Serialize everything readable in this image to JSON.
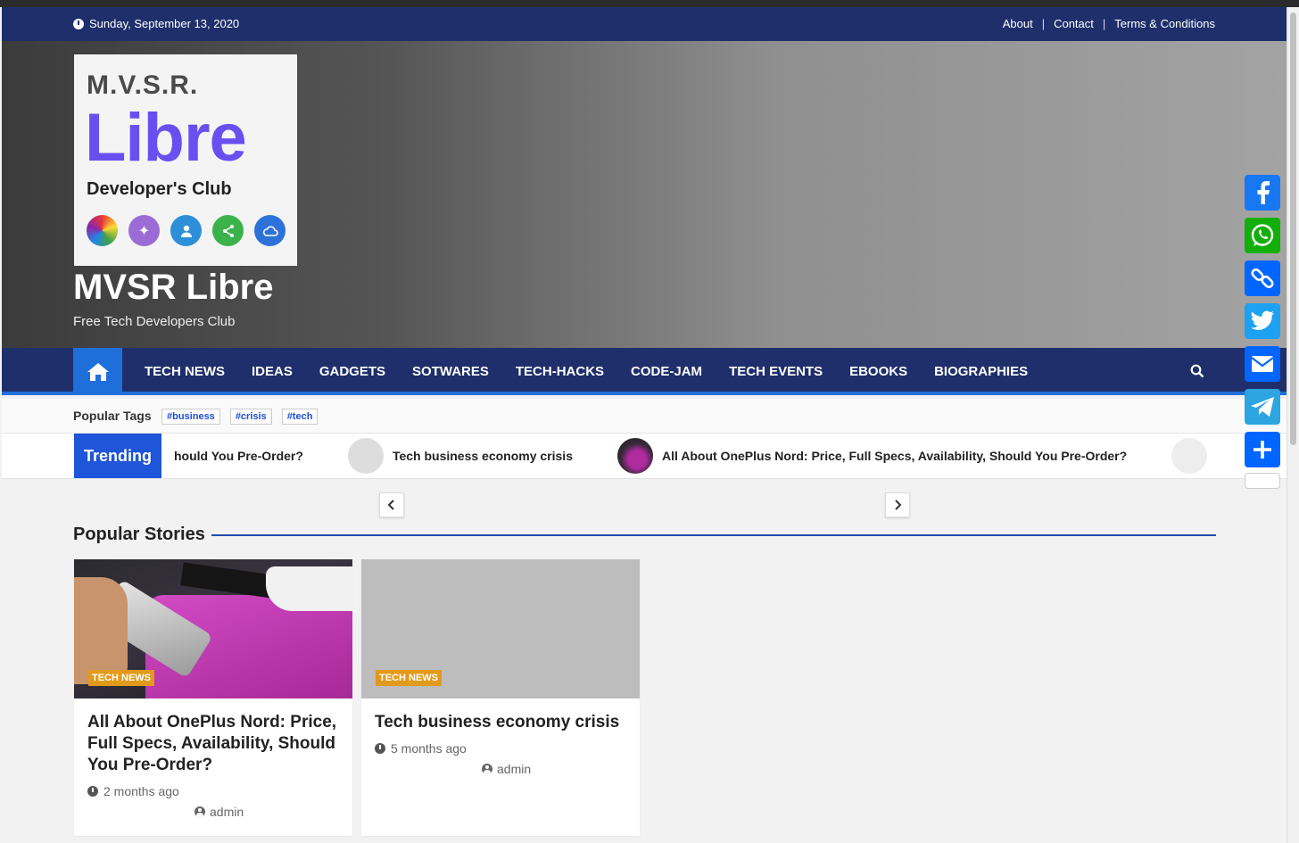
{
  "topbar": {
    "date": "Sunday, September 13, 2020",
    "links": [
      "About",
      "Contact",
      "Terms & Conditions"
    ]
  },
  "logo": {
    "line1": "M.V.S.R.",
    "line2": "Libre",
    "line3": "Developer's Club",
    "circle_colors": [
      "#e0a21a",
      "#9b6bd6",
      "#2d8fd8",
      "#3cb24a",
      "#2d72d9"
    ]
  },
  "site": {
    "title": "MVSR Libre",
    "tagline": "Free Tech Developers Club"
  },
  "nav": {
    "items": [
      "TECH NEWS",
      "IDEAS",
      "GADGETS",
      "SOTWARES",
      "TECH-HACKS",
      "CODE-JAM",
      "TECH EVENTS",
      "EBOOKS",
      "BIOGRAPHIES"
    ]
  },
  "tags": {
    "label": "Popular Tags",
    "items": [
      "#business",
      "#crisis",
      "#tech"
    ]
  },
  "trending": {
    "label": "Trending",
    "items": [
      "hould You Pre-Order?",
      "Tech business economy crisis",
      "All About OnePlus Nord: Price, Full Specs, Availability, Should You Pre-Order?"
    ]
  },
  "popular": {
    "title": "Popular Stories",
    "cards": [
      {
        "category": "TECH NEWS",
        "title": "All About OnePlus Nord: Price, Full Specs, Availability, Should You Pre-Order?",
        "time": "2 months ago",
        "author": "admin"
      },
      {
        "category": "TECH NEWS",
        "title": "Tech business economy crisis",
        "time": "5 months ago",
        "author": "admin"
      }
    ]
  },
  "share": {
    "buttons": [
      {
        "name": "facebook",
        "color": "#1877f2"
      },
      {
        "name": "whatsapp",
        "color": "#12af0a"
      },
      {
        "name": "copy-link",
        "color": "#0166ff"
      },
      {
        "name": "twitter",
        "color": "#1da1f2"
      },
      {
        "name": "email",
        "color": "#0166ff"
      },
      {
        "name": "telegram",
        "color": "#2ca5e0"
      },
      {
        "name": "share-more",
        "color": "#0166ff"
      }
    ]
  }
}
